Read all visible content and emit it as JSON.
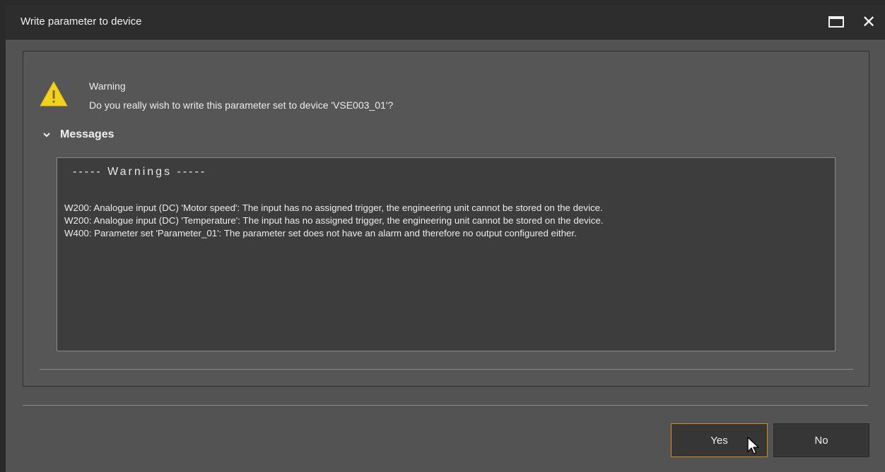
{
  "window": {
    "title": "Write parameter to device"
  },
  "titlebar_buttons": {
    "maximize_icon": "maximize-icon",
    "close_icon": "close-icon",
    "close_glyph": "✕"
  },
  "dialog": {
    "icon": "warning-icon",
    "heading": "Warning",
    "question": "Do you really wish to write this parameter set to device 'VSE003_01'?"
  },
  "messages": {
    "label": "Messages",
    "expanded": true,
    "section_heading": "----- Warnings -----",
    "lines": [
      "W200: Analogue input (DC) 'Motor speed': The input has no assigned trigger, the engineering unit cannot be stored on the device.",
      "W200: Analogue input (DC) 'Temperature': The input has no assigned trigger, the engineering unit cannot be stored on the device.",
      "W400: Parameter set 'Parameter_01': The parameter set does not have an alarm and therefore no output configured either."
    ]
  },
  "buttons": {
    "yes_label": "Yes",
    "no_label": "No"
  },
  "colors": {
    "accent_focus": "#d6891e",
    "warning_yellow": "#f2d21b",
    "titlebar_bg": "#2d2d2d",
    "panel_bg": "#535353"
  }
}
